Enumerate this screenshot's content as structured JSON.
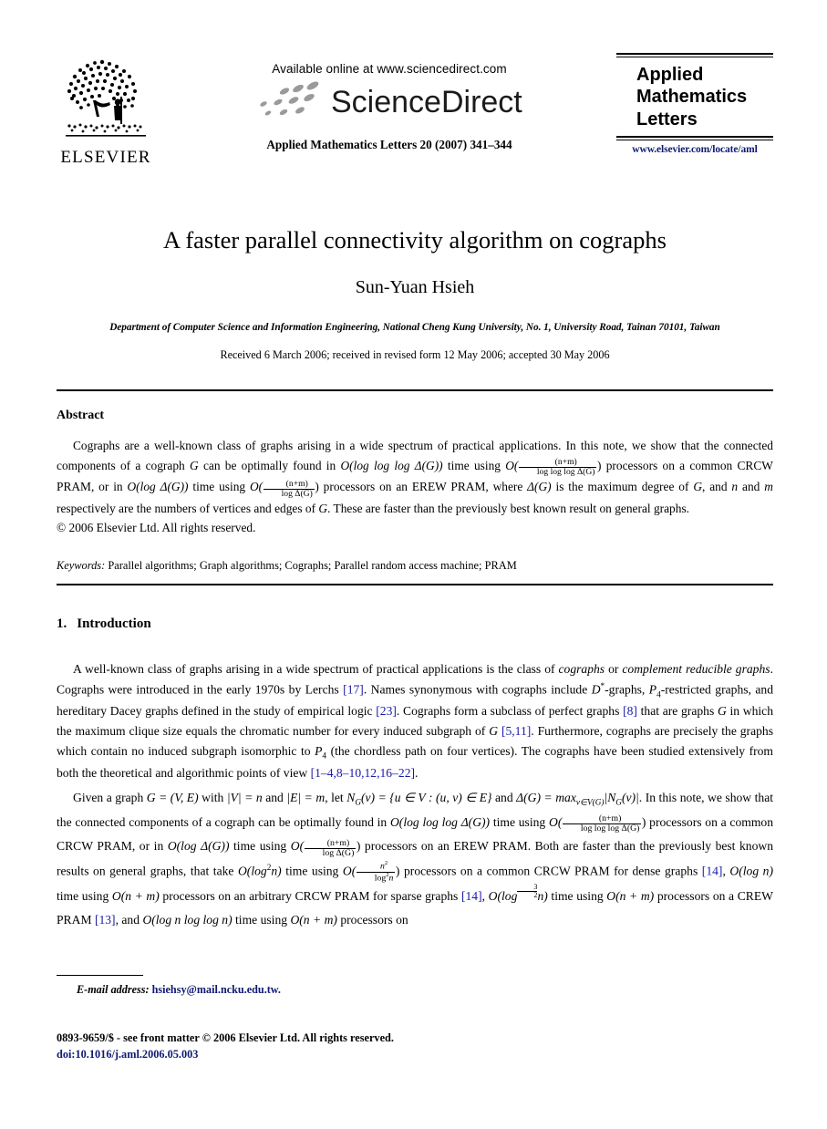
{
  "masthead": {
    "publisher_name": "ELSEVIER",
    "publisher_logo_icon": "elsevier-tree-logo",
    "available_online": "Available online at www.sciencedirect.com",
    "sciencedirect_wordmark": "ScienceDirect",
    "sciencedirect_logo_icon": "sciencedirect-swoosh-icon",
    "journal_citation": "Applied Mathematics Letters 20 (2007) 341–344",
    "journal_title_line1": "Applied",
    "journal_title_line2": "Mathematics",
    "journal_title_line3": "Letters",
    "journal_url": "www.elsevier.com/locate/aml"
  },
  "article": {
    "title": "A faster parallel connectivity algorithm on cographs",
    "author": "Sun-Yuan Hsieh",
    "affiliation": "Department of Computer Science and Information Engineering, National Cheng Kung University, No. 1, University Road, Tainan 70101, Taiwan",
    "history": "Received 6 March 2006; received in revised form 12 May 2006; accepted 30 May 2006"
  },
  "abstract": {
    "heading": "Abstract",
    "sentence_1": "Cographs are a well-known class of graphs arising in a wide spectrum of practical applications. In this note, we show that the",
    "sentence_2_a": "connected components of a cograph",
    "sentence_2_G": "G",
    "sentence_2_b": "can be optimally found in",
    "time_crcw": "O(log log log Δ(G))",
    "sentence_2_c": "time using",
    "proc_crcw_num": "(n+m)",
    "proc_crcw_den": "log log log Δ(G)",
    "sentence_2_d": "processors",
    "sentence_3_a": "on a common CRCW PRAM, or in",
    "time_erew": "O(log Δ(G))",
    "sentence_3_b": "time using",
    "proc_erew_num": "(n+m)",
    "proc_erew_den": "log Δ(G)",
    "sentence_3_c": "processors on an EREW PRAM, where",
    "sentence_3_delta": "Δ(G)",
    "sentence_3_d": "is the",
    "sentence_4_a": "maximum degree of",
    "sentence_4_G": "G",
    "sentence_4_b": ", and",
    "sentence_4_n": "n",
    "sentence_4_c": "and",
    "sentence_4_m": "m",
    "sentence_4_d": "respectively are the numbers of vertices and edges of",
    "sentence_4_G2": "G",
    "sentence_4_e": ". These are faster than the previously",
    "sentence_5": "best known result on general graphs.",
    "copyright": "© 2006 Elsevier Ltd. All rights reserved.",
    "keywords_label": "Keywords:",
    "keywords_value": "Parallel algorithms; Graph algorithms; Cographs; Parallel random access machine; PRAM"
  },
  "introduction": {
    "number": "1.",
    "heading": "Introduction",
    "p1_t1": "A well-known class of graphs arising in a wide spectrum of practical applications is the class of",
    "p1_em1": "cographs",
    "p1_t2": "or",
    "p1_em2": "complement reducible graphs",
    "p1_t3": ". Cographs were introduced in the early 1970s by Lerchs",
    "p1_r1": "[17]",
    "p1_t4": ". Names synonymous with cographs include",
    "p1_m1": "D",
    "p1_m1sup": "*",
    "p1_t5": "-graphs,",
    "p1_m2": "P",
    "p1_m2sub": "4",
    "p1_t6": "-restricted graphs, and hereditary Dacey graphs defined in the study of empirical logic",
    "p1_r2": "[23]",
    "p1_t7": ". Cographs form a subclass of perfect graphs",
    "p1_r3": "[8]",
    "p1_t8": "that are graphs",
    "p1_mG": "G",
    "p1_t9": "in which the maximum clique size equals the chromatic number for every induced subgraph of",
    "p1_mG2": "G",
    "p1_r4": "[5,11]",
    "p1_t10": ". Furthermore, cographs are precisely the graphs which contain no induced subgraph isomorphic to",
    "p1_m3": "P",
    "p1_m3sub": "4",
    "p1_t11": "(the chordless path on four vertices). The cographs have been studied extensively from both the theoretical and algorithmic points of view",
    "p1_r5": "[1–4,8–10,12,16–22]",
    "p1_t12": ".",
    "p2_t1": "Given a graph",
    "p2_m1": "G = (V, E)",
    "p2_t2": "with",
    "p2_m2": "|V| = n",
    "p2_t3": "and",
    "p2_m3": "|E| = m",
    "p2_t4": ", let",
    "p2_m4": "N",
    "p2_m4sub": "G",
    "p2_m4b": "(v) = {u ∈ V : (u, v) ∈ E}",
    "p2_t5": "and",
    "p2_m5": "Δ(G) = max",
    "p2_m5sub": "v∈V(G)",
    "p2_m5b": "|N",
    "p2_m5bsub": "G",
    "p2_m5c": "(v)|",
    "p2_t6": ". In this note, we show that the connected components of a cograph can be optimally found in",
    "p2_time1": "O(log log log Δ(G))",
    "p2_t7": "time using",
    "p2_f1num": "(n+m)",
    "p2_f1den": "log log log Δ(G)",
    "p2_t8": "processors on a common CRCW PRAM, or in",
    "p2_time2": "O(log Δ(G))",
    "p2_t9": "time using",
    "p2_f2num": "(n+m)",
    "p2_f2den": "log Δ(G)",
    "p2_t10": "processors on an EREW PRAM. Both are faster than the previously best known results on general graphs, that take",
    "p2_time3": "O(log",
    "p2_time3sup": "2",
    "p2_time3b": "n)",
    "p2_t11": "time using",
    "p2_f3num": "n",
    "p2_f3numsup": "2",
    "p2_f3den": "log",
    "p2_f3densup": "2",
    "p2_f3denb": "n",
    "p2_t12": "processors on a common CRCW PRAM for dense graphs",
    "p2_r1": "[14]",
    "p2_t13": ",",
    "p2_time4": "O(log n)",
    "p2_t14": "time using",
    "p2_proc1": "O(n + m)",
    "p2_t15": "processors on an arbitrary CRCW PRAM for sparse graphs",
    "p2_r2": "[14]",
    "p2_t16": ",",
    "p2_time5a": "O(log",
    "p2_time5n": "3",
    "p2_time5d": "2",
    "p2_time5b": "n)",
    "p2_t17": "time using",
    "p2_proc2": "O(n + m)",
    "p2_t18": "processors on a CREW PRAM",
    "p2_r3": "[13]",
    "p2_t19": ", and",
    "p2_time6": "O(log n log log n)",
    "p2_t20": "time using",
    "p2_proc3": "O(n + m)",
    "p2_t21": "processors on"
  },
  "footer": {
    "email_label": "E-mail address:",
    "email_value": "hsiehsy@mail.ncku.edu.tw.",
    "issn_line": "0893-9659/$ - see front matter © 2006 Elsevier Ltd. All rights reserved.",
    "doi": "doi:10.1016/j.aml.2006.05.003"
  },
  "colors": {
    "link_blue": "#1a1aa8",
    "url_navy": "#101a73",
    "text_black": "#000000"
  }
}
